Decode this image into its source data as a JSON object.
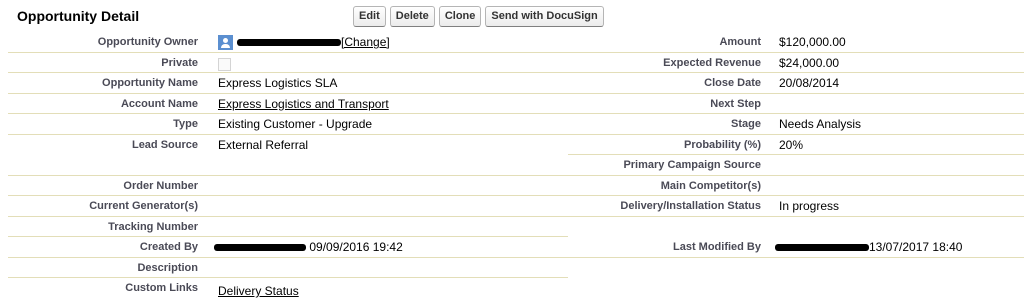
{
  "header": {
    "title": "Opportunity Detail",
    "buttons": [
      "Edit",
      "Delete",
      "Clone",
      "Send with DocuSign"
    ]
  },
  "left": {
    "owner": {
      "label": "Opportunity Owner",
      "change": "[Change]"
    },
    "private": {
      "label": "Private",
      "checked": false
    },
    "name": {
      "label": "Opportunity Name",
      "value": "Express Logistics SLA"
    },
    "account": {
      "label": "Account Name",
      "value": "Express Logistics and Transport"
    },
    "type": {
      "label": "Type",
      "value": "Existing Customer - Upgrade"
    },
    "lead_source": {
      "label": "Lead Source",
      "value": "External Referral"
    },
    "order_number": {
      "label": "Order Number",
      "value": ""
    },
    "current_generators": {
      "label": "Current Generator(s)",
      "value": ""
    },
    "tracking_number": {
      "label": "Tracking Number",
      "value": ""
    },
    "created_by": {
      "label": "Created By",
      "date": "09/09/2016 19:42"
    },
    "description": {
      "label": "Description",
      "value": ""
    },
    "custom_links": {
      "label": "Custom Links",
      "value": "Delivery Status"
    }
  },
  "right": {
    "amount": {
      "label": "Amount",
      "value": "$120,000.00"
    },
    "expected_revenue": {
      "label": "Expected Revenue",
      "value": "$24,000.00"
    },
    "close_date": {
      "label": "Close Date",
      "value": "20/08/2014"
    },
    "next_step": {
      "label": "Next Step",
      "value": ""
    },
    "stage": {
      "label": "Stage",
      "value": "Needs Analysis"
    },
    "probability": {
      "label": "Probability (%)",
      "value": "20%"
    },
    "primary_campaign": {
      "label": "Primary Campaign Source",
      "value": ""
    },
    "main_competitors": {
      "label": "Main Competitor(s)",
      "value": ""
    },
    "delivery_status": {
      "label": "Delivery/Installation Status",
      "value": "In progress"
    },
    "last_modified_by": {
      "label": "Last Modified By",
      "date": "13/07/2017 18:40"
    }
  },
  "colors": {
    "label_text": "#4a4a56",
    "divider": "#e3deb8",
    "user_icon": "#5b8fd0"
  },
  "icons": {
    "owner": "user-icon"
  }
}
